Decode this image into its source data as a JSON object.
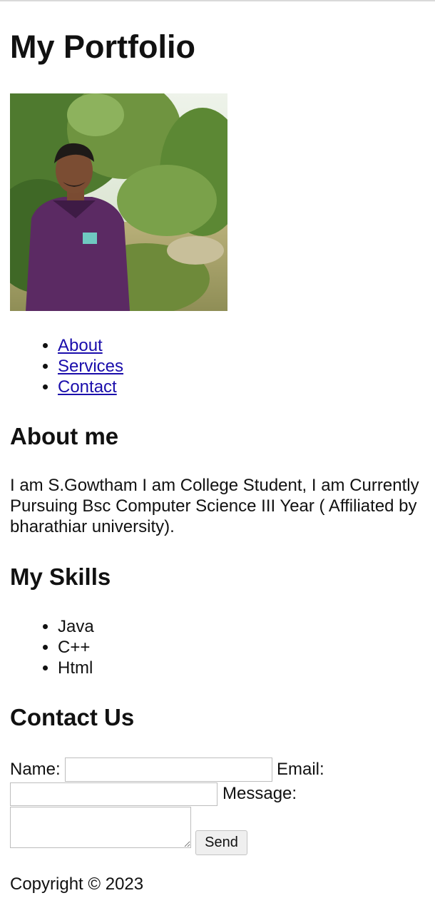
{
  "header": {
    "title": "My Portfolio"
  },
  "profile_photo": {
    "icon": "person-photo"
  },
  "nav": {
    "items": [
      {
        "label": "About"
      },
      {
        "label": "Services"
      },
      {
        "label": "Contact"
      }
    ]
  },
  "about": {
    "heading": "About me",
    "text": "I am S.Gowtham I am College Student, I am Currently Pursuing Bsc Computer Science III Year ( Affiliated by bharathiar university)."
  },
  "skills": {
    "heading": "My Skills",
    "items": [
      "Java",
      "C++",
      "Html"
    ]
  },
  "contact": {
    "heading": "Contact Us",
    "name_label": "Name:",
    "name_value": "",
    "email_label": "Email:",
    "email_value": "",
    "message_label": "Message:",
    "message_value": "",
    "send_label": "Send"
  },
  "footer": {
    "copyright": "Copyright © 2023"
  },
  "colors": {
    "link": "#1a0dab",
    "text": "#111111",
    "shirt": "#5b2a63"
  }
}
